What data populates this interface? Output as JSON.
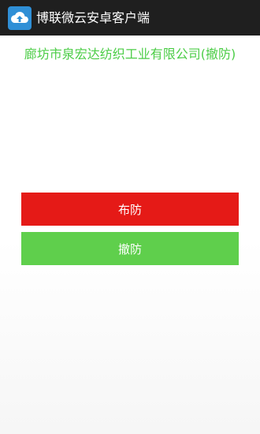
{
  "titlebar": {
    "title": "博联微云安卓客户端",
    "icon": "cloud-upload-icon"
  },
  "company": {
    "name": "廊坊市泉宏达纺织工业有限公司(撤防)",
    "status_color": "#4ccd47"
  },
  "actions": {
    "arm_label": "布防",
    "disarm_label": "撤防",
    "arm_color": "#e51a17",
    "disarm_color": "#5fcf4c"
  }
}
